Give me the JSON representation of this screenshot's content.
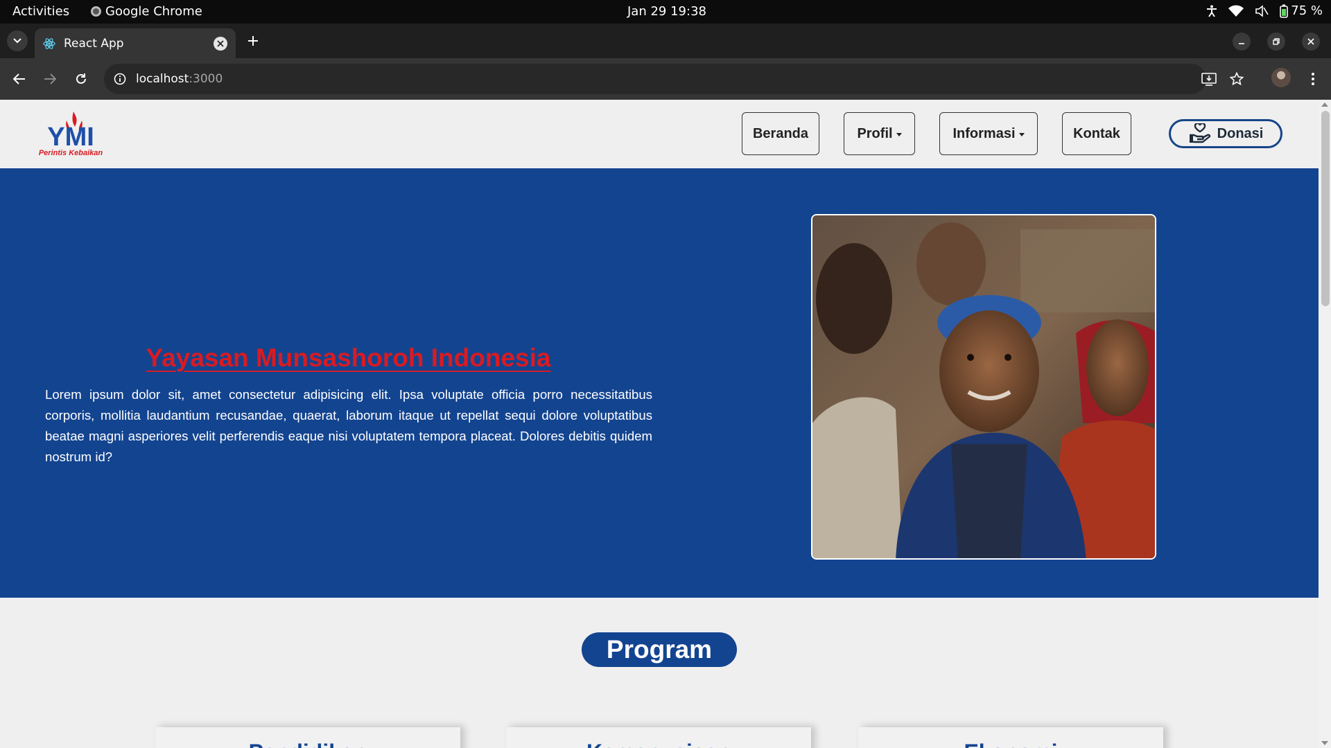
{
  "os_bar": {
    "activities": "Activities",
    "app_name": "Google Chrome",
    "datetime": "Jan 29  19:38",
    "battery": "75 %"
  },
  "browser": {
    "tab_title": "React App",
    "url_host": "localhost",
    "url_port": ":3000"
  },
  "site": {
    "nav": {
      "beranda": "Beranda",
      "profil": "Profil",
      "informasi": "Informasi",
      "kontak": "Kontak",
      "donasi": "Donasi"
    },
    "logo": {
      "mark": "YMI",
      "tagline": "Perintis Kebaikan"
    },
    "hero": {
      "title": "Yayasan Munsashoroh Indonesia",
      "text": "Lorem ipsum dolor sit, amet consectetur adipisicing elit. Ipsa voluptate officia porro necessitatibus corporis, mollitia laudantium recusandae, quaerat, laborum itaque ut repellat sequi dolore voluptatibus beatae magni asperiores velit perferendis eaque nisi voluptatem tempora placeat. Dolores debitis quidem nostrum id?"
    },
    "program": {
      "heading": "Program",
      "cards": [
        "Pendidikan",
        "Kemanusiaan",
        "Ekonomi"
      ]
    }
  },
  "colors": {
    "brand_blue": "#134490",
    "brand_red": "#d91b22"
  }
}
